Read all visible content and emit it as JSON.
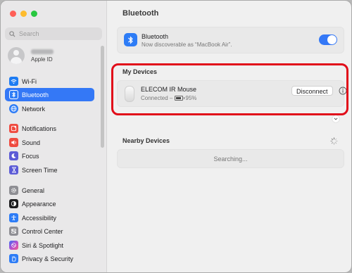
{
  "window": {
    "title": "Bluetooth"
  },
  "sidebar": {
    "search_placeholder": "Search",
    "account": {
      "subtitle": "Apple ID"
    },
    "items": [
      {
        "label": "Wi-Fi",
        "icon": "wifi-icon",
        "color": "#1e7cf3"
      },
      {
        "label": "Bluetooth",
        "icon": "bluetooth-icon",
        "color": "#2d7cf6",
        "selected": true
      },
      {
        "label": "Network",
        "icon": "globe-icon",
        "color": "#2d7cf6"
      },
      {
        "label": "Notifications",
        "icon": "bell-icon",
        "color": "#ef4b40"
      },
      {
        "label": "Sound",
        "icon": "speaker-icon",
        "color": "#ef4b40"
      },
      {
        "label": "Focus",
        "icon": "moon-icon",
        "color": "#5c5bd6"
      },
      {
        "label": "Screen Time",
        "icon": "hourglass-icon",
        "color": "#5c5bd6"
      },
      {
        "label": "General",
        "icon": "gear-icon",
        "color": "#8e8e93"
      },
      {
        "label": "Appearance",
        "icon": "appearance-icon",
        "color": "#1c1c1e"
      },
      {
        "label": "Accessibility",
        "icon": "accessibility-icon",
        "color": "#2d7cf6"
      },
      {
        "label": "Control Center",
        "icon": "control-center-icon",
        "color": "#8e8e93"
      },
      {
        "label": "Siri & Spotlight",
        "icon": "siri-icon",
        "color": "#b44fd2"
      },
      {
        "label": "Privacy & Security",
        "icon": "hand-icon",
        "color": "#2d7cf6"
      }
    ]
  },
  "bluetooth": {
    "name": "Bluetooth",
    "status": "Now discoverable as “MacBook Air”.",
    "enabled": true
  },
  "my_devices": {
    "label": "My Devices",
    "devices": [
      {
        "name": "ELECOM IR Mouse",
        "status": "Connected –",
        "battery": "95%",
        "action": "Disconnect"
      }
    ]
  },
  "nearby": {
    "label": "Nearby Devices",
    "status": "Searching..."
  },
  "colors": {
    "accent": "#3478f6",
    "highlight": "#e10d1a"
  }
}
